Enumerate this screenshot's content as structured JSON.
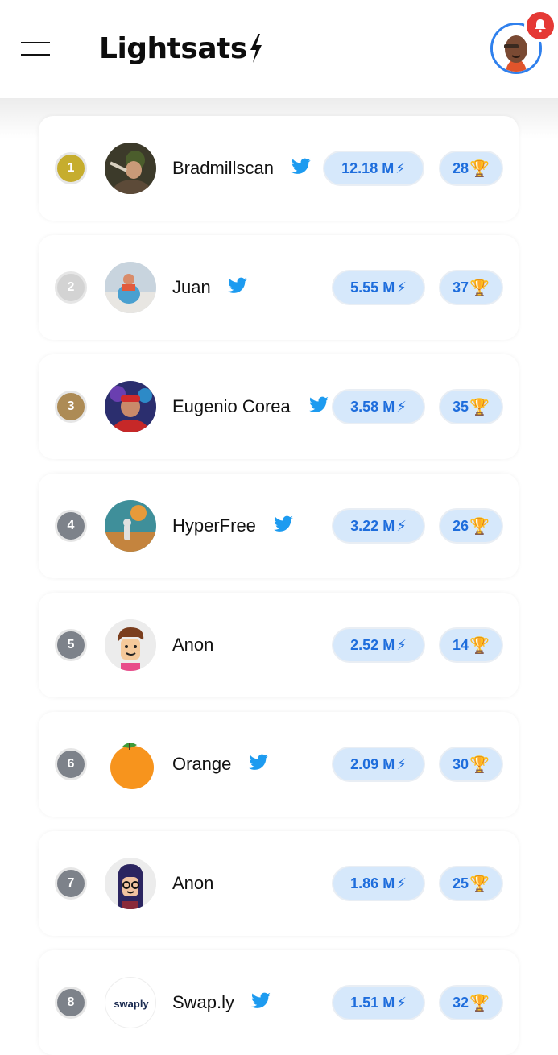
{
  "header": {
    "app_title": "Lightsats",
    "menu_icon": "hamburger-menu-icon",
    "notification_icon": "bell-icon",
    "colors": {
      "avatar_ring": "#2f80ed",
      "notification": "#e53935"
    }
  },
  "leaderboard": [
    {
      "rank": "1",
      "name": "Bradmillscan",
      "twitter": true,
      "sats": "12.18 M",
      "trophies": "28",
      "rank_color": "#c6ad2e"
    },
    {
      "rank": "2",
      "name": "Juan",
      "twitter": true,
      "sats": "5.55 M",
      "trophies": "37",
      "rank_color": "#d3d3d3"
    },
    {
      "rank": "3",
      "name": "Eugenio Corea",
      "twitter": true,
      "sats": "3.58 M",
      "trophies": "35",
      "rank_color": "#ad8b55"
    },
    {
      "rank": "4",
      "name": "HyperFree",
      "twitter": true,
      "sats": "3.22 M",
      "trophies": "26",
      "rank_color": "#7d828a"
    },
    {
      "rank": "5",
      "name": "Anon",
      "twitter": false,
      "sats": "2.52 M",
      "trophies": "14",
      "rank_color": "#7d828a"
    },
    {
      "rank": "6",
      "name": "Orange",
      "twitter": true,
      "sats": "2.09 M",
      "trophies": "30",
      "rank_color": "#7d828a"
    },
    {
      "rank": "7",
      "name": "Anon",
      "twitter": false,
      "sats": "1.86 M",
      "trophies": "25",
      "rank_color": "#7d828a"
    },
    {
      "rank": "8",
      "name": "Swap.ly",
      "twitter": true,
      "sats": "1.51 M",
      "trophies": "32",
      "rank_color": "#7d828a"
    }
  ],
  "logos": {
    "swaply": "swaply"
  },
  "colors": {
    "twitter": "#1d9bf0",
    "pill_bg": "#d6e8fb",
    "pill_text": "#1e6ddc"
  }
}
